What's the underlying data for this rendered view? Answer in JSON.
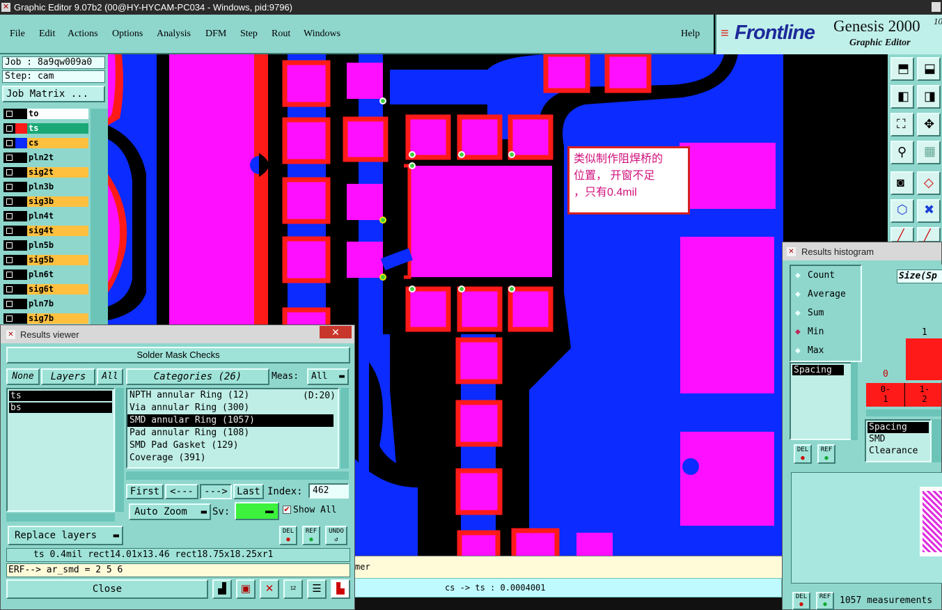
{
  "window": {
    "title": "Graphic Editor 9.07b2 (00@HY-HYCAM-PC034 - Windows, pid:9796)"
  },
  "menu": {
    "items": [
      "File",
      "Edit",
      "Actions",
      "Options",
      "Analysis",
      "DFM",
      "Step",
      "Rout",
      "Windows"
    ],
    "help": "Help"
  },
  "logo": {
    "brand": "Frontline",
    "product": "Genesis 2000",
    "version": "10",
    "subtitle": "Graphic Editor"
  },
  "job": {
    "job": "Job : 8a9qw009a0",
    "step": "Step: cam",
    "matrix_button": "Job Matrix ..."
  },
  "layers": [
    {
      "name": "to",
      "color": "#ffffff"
    },
    {
      "name": "ts",
      "color": "#1aa876"
    },
    {
      "name": "cs",
      "color": "#ffc040"
    },
    {
      "name": "pln2t",
      "color": "#8fd7cd"
    },
    {
      "name": "sig2t",
      "color": "#ffc040"
    },
    {
      "name": "pln3b",
      "color": "#8fd7cd"
    },
    {
      "name": "sig3b",
      "color": "#ffc040"
    },
    {
      "name": "pln4t",
      "color": "#8fd7cd"
    },
    {
      "name": "sig4t",
      "color": "#ffc040"
    },
    {
      "name": "pln5b",
      "color": "#8fd7cd"
    },
    {
      "name": "sig5b",
      "color": "#ffc040"
    },
    {
      "name": "pln6t",
      "color": "#8fd7cd"
    },
    {
      "name": "sig6t",
      "color": "#ffc040"
    },
    {
      "name": "pln7b",
      "color": "#8fd7cd"
    },
    {
      "name": "sig7b",
      "color": "#ffc040"
    }
  ],
  "annotation": {
    "text_line1": "类似制作阻焊桥的",
    "text_line2": "位置， 开窗不足",
    "text_line3": "，只有0.4mil"
  },
  "canvas": {
    "status": "cs -> ts : 0.0004001",
    "partial_label": "mer"
  },
  "results_viewer": {
    "title": "Results viewer",
    "header": "Solder Mask Checks",
    "none": "None",
    "layers": "Layers",
    "all": "All",
    "categories": "Categories (26)",
    "meas_label": "Meas:",
    "meas_value": "All",
    "layer_list": [
      "ts",
      "bs"
    ],
    "category_list": [
      "NPTH annular Ring (12)",
      "Via annular Ring (300)",
      "SMD annular Ring (1057)",
      "Pad annular Ring (108)",
      "SMD Pad Gasket (129)",
      "Coverage (391)"
    ],
    "category_note": "(D:20)",
    "first": "First",
    "prev": "<---",
    "next": "--->",
    "last": "Last",
    "index_label": "Index:",
    "index_value": "462",
    "auto_zoom": "Auto Zoom",
    "sv_label": "Sv:",
    "show_all": "Show All",
    "replace_layers": "Replace layers",
    "del": "DEL",
    "ref": "REF",
    "undo": "UNDO",
    "info": "ts 0.4mil   rect14.01x13.46   rect18.75x18.25xr1",
    "erf": "ERF--> ar_smd = 2 5 6",
    "close": "Close"
  },
  "histogram": {
    "title": "Results histogram",
    "options": [
      "Count",
      "Average",
      "Sum",
      "Min",
      "Max"
    ],
    "selected": "Min",
    "list_item": "Spacing",
    "size_header": "Size(Sp",
    "bar_label": "1",
    "axis_zero": "0",
    "bins": [
      "0-\n1",
      "1-\n2"
    ],
    "lower_list": [
      "Spacing",
      "SMD",
      "Clearance"
    ],
    "del": "DEL",
    "ref": "REF",
    "footer": "1057 measurements"
  },
  "colors": {
    "copper": "#0b2bff",
    "mask": "#ff0fff",
    "pad_outline": "#ff1a1a",
    "bg": "#000000",
    "panel": "#8fd7cd"
  }
}
